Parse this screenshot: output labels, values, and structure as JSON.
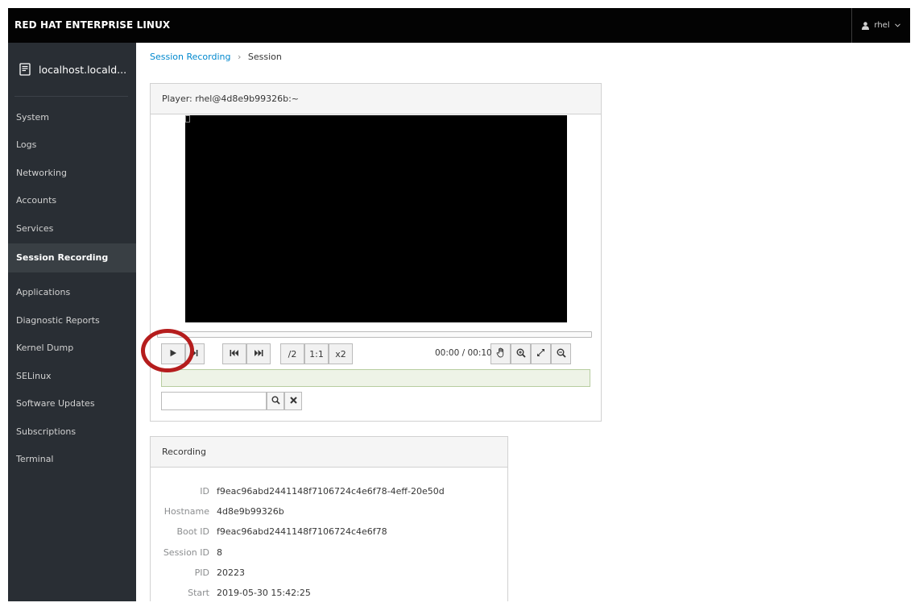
{
  "header": {
    "brand": "RED HAT ENTERPRISE LINUX",
    "user": "rhel"
  },
  "sidebar": {
    "host": "localhost.locald...",
    "items": [
      {
        "label": "System"
      },
      {
        "label": "Logs"
      },
      {
        "label": "Networking"
      },
      {
        "label": "Accounts"
      },
      {
        "label": "Services"
      },
      {
        "label": "Session Recording"
      },
      {
        "label": "Applications"
      },
      {
        "label": "Diagnostic Reports"
      },
      {
        "label": "Kernel Dump"
      },
      {
        "label": "SELinux"
      },
      {
        "label": "Software Updates"
      },
      {
        "label": "Subscriptions"
      },
      {
        "label": "Terminal"
      }
    ]
  },
  "breadcrumb": {
    "parent": "Session Recording",
    "separator": "›",
    "current": "Session"
  },
  "player": {
    "title": "Player: rhel@4d8e9b99326b:~",
    "progress": 0,
    "time": "00:00 / 00:10",
    "speed_half": "/2",
    "speed_normal": "1:1",
    "speed_double": "x2",
    "search_value": "",
    "icons": {
      "play": "play-icon",
      "step": "step-icon",
      "skip_back": "skip-backward-icon",
      "skip_forward": "skip-forward-icon",
      "drag": "hand-icon",
      "zoom_in": "zoom-in-icon",
      "fit": "expand-icon",
      "zoom_out": "zoom-out-icon",
      "search": "search-icon",
      "clear": "close-icon"
    }
  },
  "recording": {
    "title": "Recording",
    "fields": [
      {
        "label": "ID",
        "value": "f9eac96abd2441148f7106724c4e6f78-4eff-20e50d"
      },
      {
        "label": "Hostname",
        "value": "4d8e9b99326b"
      },
      {
        "label": "Boot ID",
        "value": "f9eac96abd2441148f7106724c4e6f78"
      },
      {
        "label": "Session ID",
        "value": "8"
      },
      {
        "label": "PID",
        "value": "20223"
      },
      {
        "label": "Start",
        "value": "2019-05-30 15:42:25"
      }
    ]
  },
  "colors": {
    "accent": "#0088ce",
    "highlight_ring": "#b51d1d",
    "sidebar_bg": "#292e34",
    "topbar_bg": "#030303"
  }
}
